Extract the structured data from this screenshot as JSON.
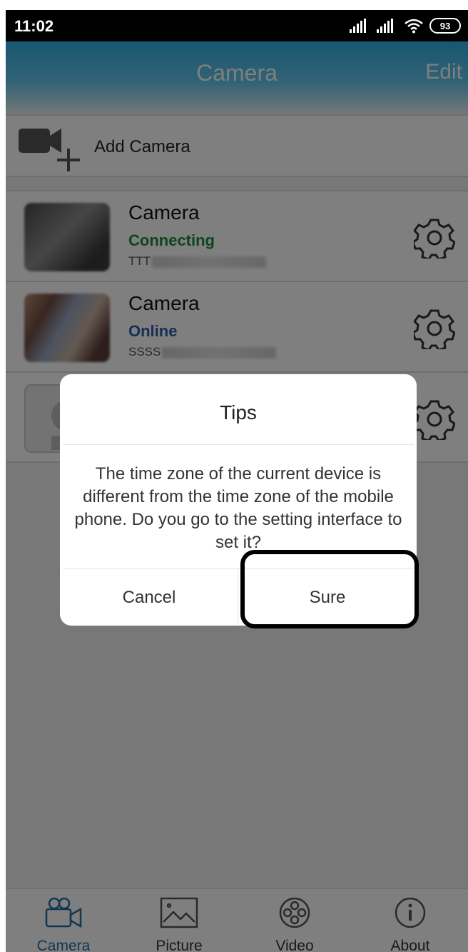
{
  "status_bar": {
    "time": "11:02",
    "battery": "93"
  },
  "header": {
    "title": "Camera",
    "edit_label": "Edit"
  },
  "add_camera": {
    "label": "Add Camera"
  },
  "cameras": [
    {
      "name": "Camera",
      "status": "Connecting",
      "status_color": "#1f8a3a",
      "id_prefix": "TTT"
    },
    {
      "name": "Camera",
      "status": "Online",
      "status_color": "#2c5eaa",
      "id_prefix": "SSSS"
    }
  ],
  "nav": [
    {
      "label": "Camera",
      "icon": "camera-icon",
      "active": true
    },
    {
      "label": "Picture",
      "icon": "picture-icon",
      "active": false
    },
    {
      "label": "Video",
      "icon": "video-reel-icon",
      "active": false
    },
    {
      "label": "About",
      "icon": "info-icon",
      "active": false
    }
  ],
  "dialog": {
    "title": "Tips",
    "message": "The time zone of the current device is different from the time zone of the mobile phone. Do you go to the setting interface to set it?",
    "cancel_label": "Cancel",
    "sure_label": "Sure"
  },
  "colors": {
    "header": "#2db0e3",
    "active_nav": "#1e6fa8"
  }
}
